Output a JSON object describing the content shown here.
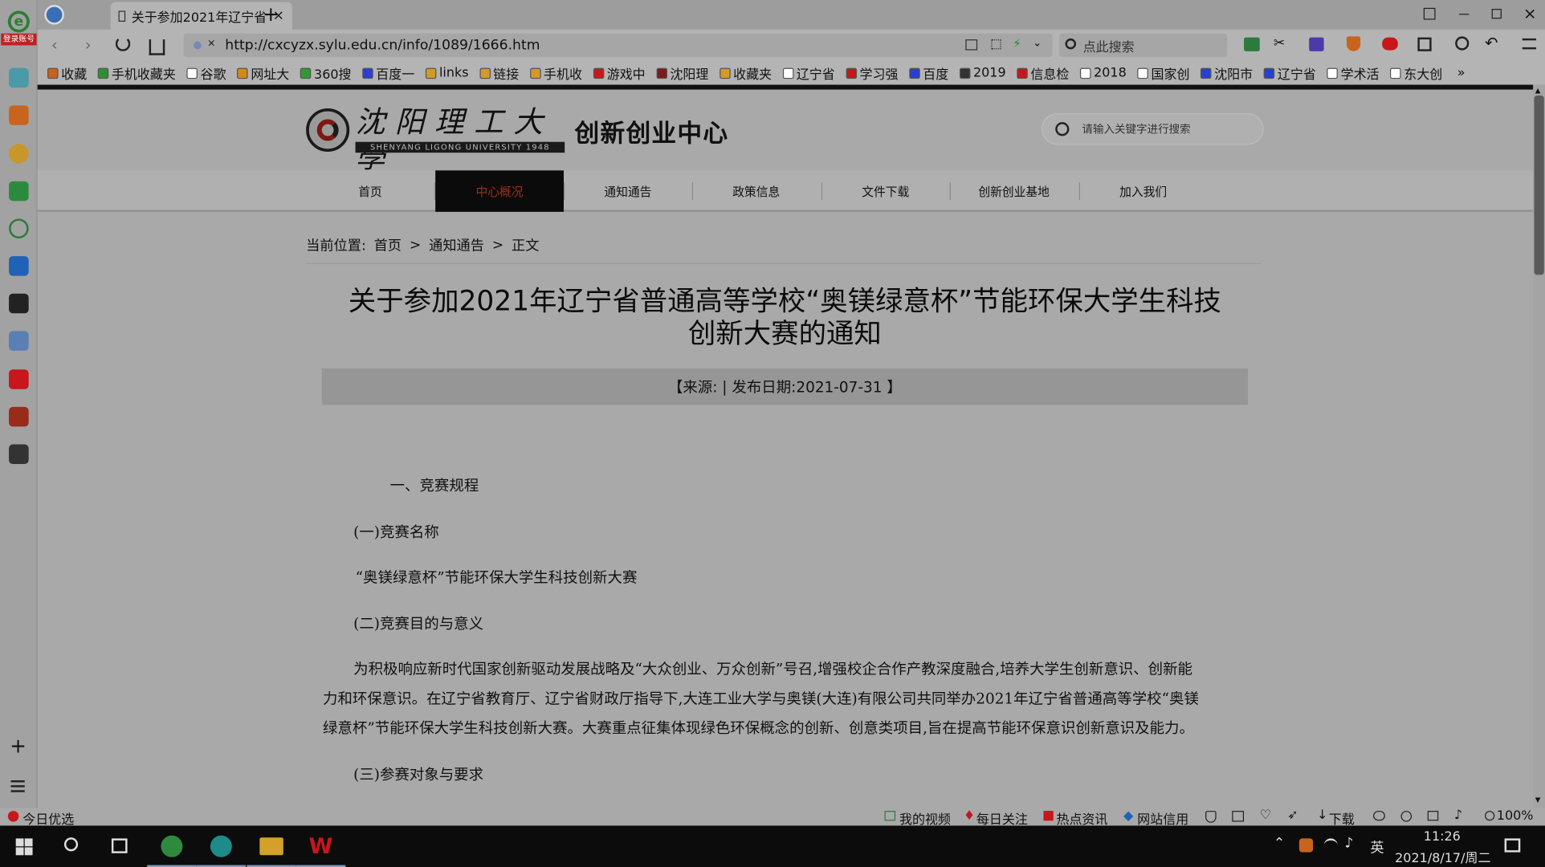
{
  "browser": {
    "sidebar_badge": "登录账号",
    "tab_title": "关于参加2021年辽宁省",
    "new_tab": "+",
    "url": "http://cxcyzx.sylu.edu.cn/info/1089/1666.htm",
    "search_placeholder": "点此搜索",
    "bookmarks": [
      {
        "label": "收藏",
        "icon": "star-icon",
        "color": "#c8621b"
      },
      {
        "label": "手机收藏夹",
        "icon": "phone-icon",
        "color": "#2f8f2f"
      },
      {
        "label": "谷歌",
        "icon": "page-icon",
        "color": "#ffffff"
      },
      {
        "label": "网址大",
        "icon": "globe-icon",
        "color": "#d08a18"
      },
      {
        "label": "360搜",
        "icon": "search360-icon",
        "color": "#2f9a2f"
      },
      {
        "label": "百度一",
        "icon": "baidu-paw-icon",
        "color": "#2a3fd0"
      },
      {
        "label": "links",
        "icon": "folder-icon",
        "color": "#d29a2a"
      },
      {
        "label": "链接",
        "icon": "folder-icon",
        "color": "#d29a2a"
      },
      {
        "label": "手机收",
        "icon": "folder-icon",
        "color": "#d29a2a"
      },
      {
        "label": "游戏中",
        "icon": "game-icon",
        "color": "#c8161b"
      },
      {
        "label": "沈阳理",
        "icon": "sylu-icon",
        "color": "#7a1b1b"
      },
      {
        "label": "收藏夹",
        "icon": "folder-icon",
        "color": "#d29a2a"
      },
      {
        "label": "辽宁省",
        "icon": "page-icon",
        "color": "#ffffff"
      },
      {
        "label": "学习强",
        "icon": "xuexi-icon",
        "color": "#c8161b"
      },
      {
        "label": "百度",
        "icon": "baidu-paw-icon",
        "color": "#2a3fd0"
      },
      {
        "label": "2019",
        "icon": "gear-icon",
        "color": "#333333"
      },
      {
        "label": "信息检",
        "icon": "info-icon",
        "color": "#c8161b"
      },
      {
        "label": "2018",
        "icon": "page-icon",
        "color": "#ffffff"
      },
      {
        "label": "国家创",
        "icon": "page-icon",
        "color": "#ffffff"
      },
      {
        "label": "沈阳市",
        "icon": "kr-icon",
        "color": "#2a3fd0"
      },
      {
        "label": "辽宁省",
        "icon": "site-icon",
        "color": "#2a3fd0"
      },
      {
        "label": "学术活",
        "icon": "page-icon",
        "color": "#ffffff"
      },
      {
        "label": "东大创",
        "icon": "page-icon",
        "color": "#ffffff"
      }
    ],
    "bookmarks_more": "»"
  },
  "site": {
    "logo_title": "创新创业中心",
    "logo_english": "SHENYANG LIGONG UNIVERSITY 1948",
    "search_placeholder": "请输入关键字进行搜索",
    "nav": [
      "首页",
      "中心概况",
      "通知通告",
      "政策信息",
      "文件下载",
      "创新创业基地",
      "加入我们"
    ],
    "active_nav_index": 1
  },
  "breadcrumb": {
    "label": "当前位置:",
    "items": [
      "首页",
      "通知通告",
      "正文"
    ],
    "separator": ">"
  },
  "article": {
    "title_line1": "关于参加2021年辽宁省普通高等学校“奥镁绿意杯”节能环保大学生科技",
    "title_line2": "创新大赛的通知",
    "meta": "【来源:  | 发布日期:2021-07-31 】",
    "sections": {
      "h1": "一、竞赛规程",
      "h1_1": "(一)竞赛名称",
      "p1": "“奥镁绿意杯”节能环保大学生科技创新大赛",
      "h1_2": "(二)竞赛目的与意义",
      "p2_line1": "为积极响应新时代国家创新驱动发展战略及“大众创业、万众创新”号召,增强校企合作产教深度融合,培养大学生创新意识、创新能",
      "p2_line2": "力和环保意识。在辽宁省教育厅、辽宁省财政厅指导下,大连工业大学与奥镁(大连)有限公司共同举办2021年辽宁省普通高等学校“奥镁",
      "p2_line3": "绿意杯”节能环保大学生科技创新大赛。大赛重点征集体现绿色环保概念的创新、创意类项目,旨在提高节能环保意识创新意识及能力。",
      "h1_3": "(三)参赛对象与要求"
    }
  },
  "statusbar": {
    "left": "今日优选",
    "items": [
      "我的视频",
      "每日关注",
      "热点资讯",
      "网站信用"
    ],
    "download": "下载",
    "zoom": "100%"
  },
  "taskbar": {
    "ime": "英",
    "time": "11:26",
    "date": "2021/8/17/周二"
  }
}
